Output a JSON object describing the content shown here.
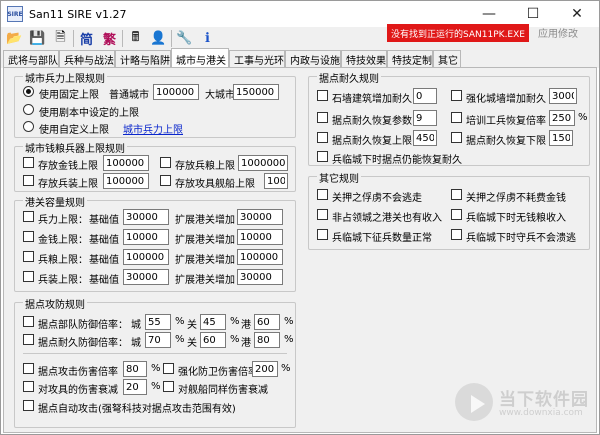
{
  "app": {
    "icon_text": "SIRE",
    "title": "San11 SIRE v1.27"
  },
  "window_controls": {
    "minimize": "—",
    "maximize": "☐",
    "close": "✕"
  },
  "toolbar": {
    "buttons": [
      {
        "name": "open",
        "glyph": "📂"
      },
      {
        "name": "save",
        "glyph": "💾"
      },
      {
        "name": "save-as",
        "glyph": "🗎"
      },
      {
        "name": "simplified",
        "glyph": "简"
      },
      {
        "name": "traditional",
        "glyph": "繁"
      },
      {
        "name": "calculator",
        "glyph": "🖩"
      },
      {
        "name": "officer",
        "glyph": "👤"
      },
      {
        "name": "settings",
        "glyph": "🔧"
      },
      {
        "name": "info",
        "glyph": "ℹ"
      }
    ],
    "warning": "没有找到正运行的SAN11PK.EXE",
    "apply_label": "应用修改"
  },
  "tabs": [
    "武将与部队",
    "兵种与战法",
    "计略与陷阱",
    "城市与港关",
    "工事与光环",
    "内政与设施",
    "特技效果",
    "特技定制",
    "其它"
  ],
  "active_tab": "城市与港关",
  "city_troop": {
    "title": "城市兵力上限规则",
    "opt_fixed": "使用固定上限",
    "normal_label": "普通城市",
    "normal_value": "100000",
    "big_label": "大城市",
    "big_value": "150000",
    "opt_script": "使用剧本中设定的上限",
    "opt_custom": "使用自定义上限",
    "link": "城市兵力上限"
  },
  "city_res": {
    "title": "城市钱粮兵器上限规则",
    "gold_label": "存放金钱上限",
    "gold_value": "100000",
    "food_label": "存放兵粮上限",
    "food_value": "1000000",
    "arms_label": "存放兵装上限",
    "arms_value": "100000",
    "ship_label": "存放攻具舰船上限",
    "ship_value": "100"
  },
  "port": {
    "title": "港关容量规则",
    "base_label": "基础值",
    "expand_label": "扩展港关增加",
    "rows": [
      {
        "label": "兵力上限：",
        "base": "30000",
        "expand": "30000"
      },
      {
        "label": "金钱上限：",
        "base": "10000",
        "expand": "10000"
      },
      {
        "label": "兵粮上限：",
        "base": "100000",
        "expand": "100000"
      },
      {
        "label": "兵装上限：",
        "base": "30000",
        "expand": "30000"
      }
    ]
  },
  "defense": {
    "title": "据点攻防规则",
    "row1_label": "据点部队防御倍率：",
    "row2_label": "据点耐久防御倍率：",
    "city_label": "城",
    "pass_label": "关",
    "port_label": "港",
    "pct": "%",
    "row1": {
      "city": "55",
      "pass": "45",
      "port": "60"
    },
    "row2": {
      "city": "70",
      "pass": "60",
      "port": "80"
    },
    "attack_dmg_label": "据点攻击伤害倍率",
    "attack_dmg_value": "80",
    "enh_guard_label": "强化防卫伤害倍率",
    "enh_guard_value": "200",
    "weapon_dec_label": "对攻具的伤害衰减",
    "weapon_dec_value": "20",
    "ship_same_label": "对舰船同样伤害衰减",
    "auto_attack_label": "据点自动攻击(强弩科技对据点攻击范围有效)"
  },
  "durability": {
    "title": "据点耐久规则",
    "stone_label": "石墙建筑增加耐久",
    "stone_value": "0",
    "strong_wall_label": "强化城墙增加耐久",
    "strong_wall_value": "3000",
    "recover_param_label": "据点耐久恢复参数",
    "recover_param_value": "9",
    "train_rate_label": "培训工兵恢复倍率",
    "train_rate_value": "250",
    "pct": "%",
    "recover_max_label": "据点耐久恢复上限",
    "recover_max_value": "450",
    "recover_min_label": "据点耐久恢复下限",
    "recover_min_value": "150",
    "siege_label": "兵临城下时据点仍能恢复耐久"
  },
  "other": {
    "title": "其它规则",
    "items": [
      "关押之俘虏不会逃走",
      "关押之俘虏不耗费金钱",
      "非占领城之港关也有收入",
      "兵临城下时无钱粮收入",
      "兵临城下征兵数量正常",
      "兵临城下时守兵不会溃逃"
    ]
  },
  "watermark": {
    "line1": "当下软件园",
    "line2": "www.downxia.com"
  }
}
